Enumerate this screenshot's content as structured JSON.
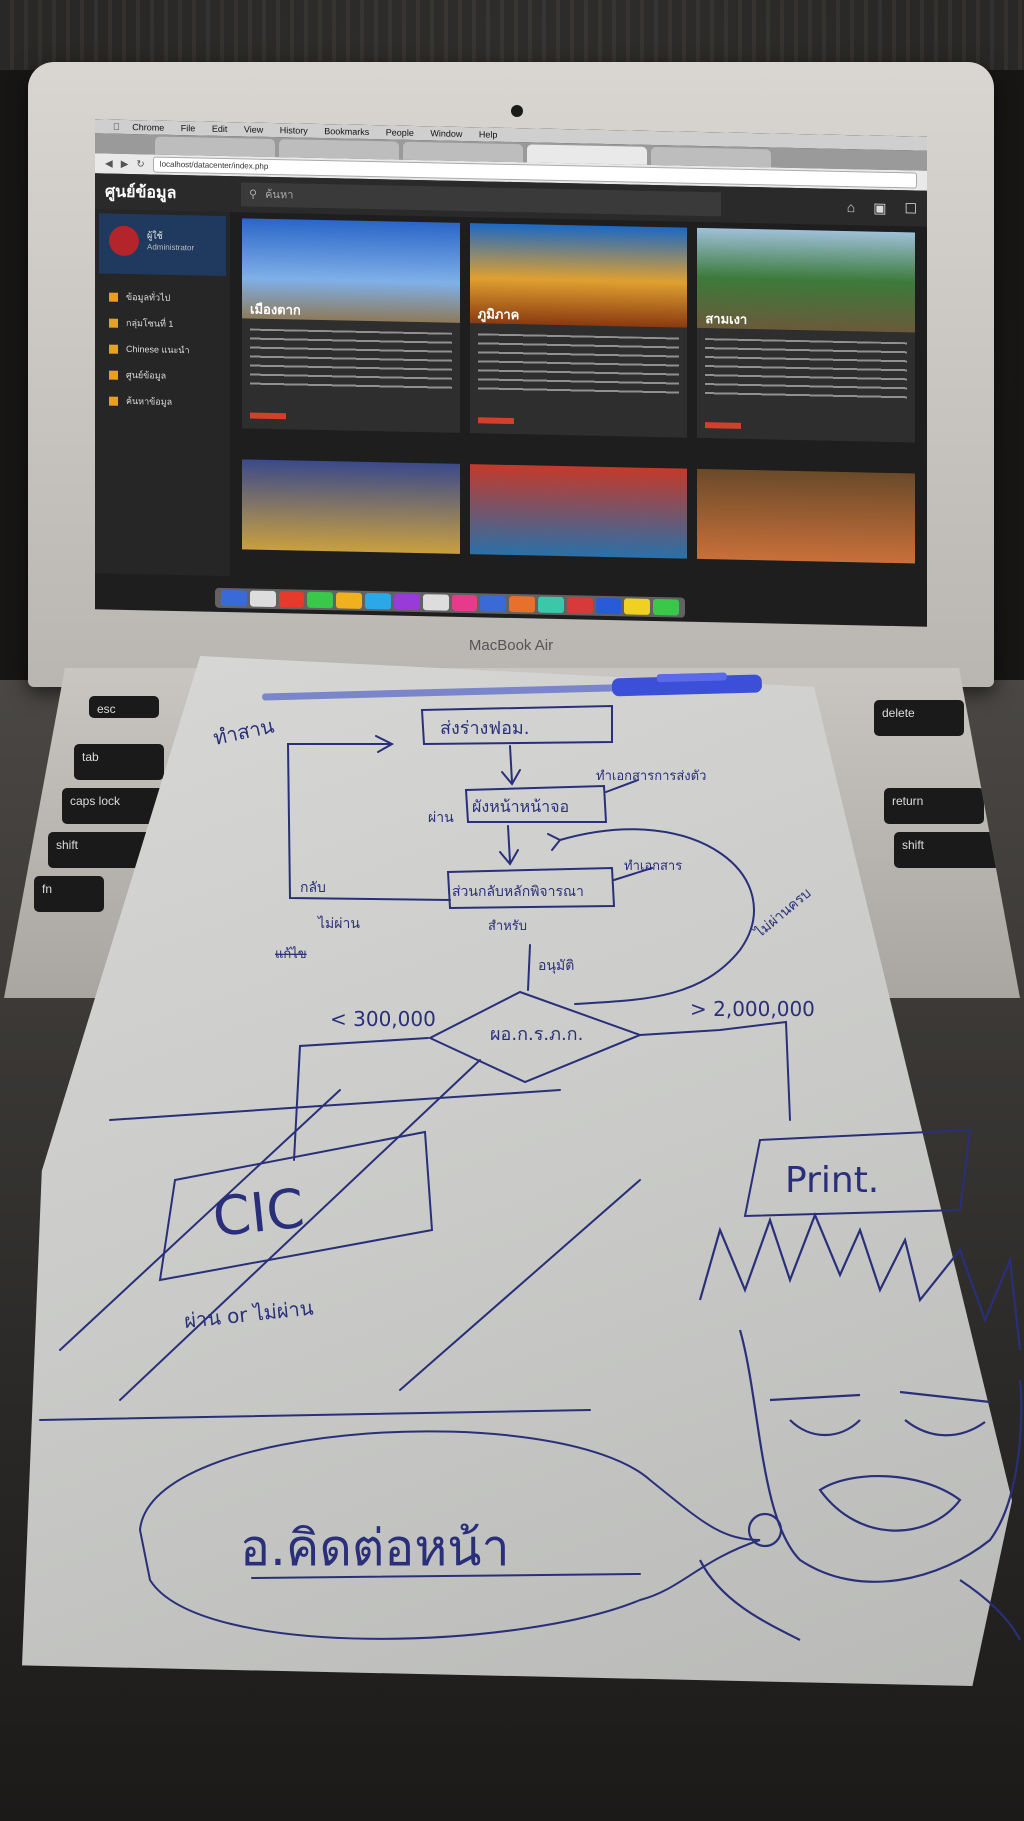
{
  "browser": {
    "menubar": [
      "Chrome",
      "File",
      "Edit",
      "View",
      "History",
      "Bookmarks",
      "People",
      "Window",
      "Help"
    ],
    "url": "localhost/datacenter/index.php"
  },
  "website": {
    "logo": "ศูนย์ข้อมูล",
    "search_placeholder": "ค้นหา",
    "profile_name": "ผู้ใช้",
    "profile_role": "Administrator",
    "sidebar_items": [
      "ข้อมูลทั่วไป",
      "กลุ่มโซนที่ 1",
      "Chinese แนะนำ",
      "ศูนย์ข้อมูล",
      "ค้นหาข้อมูล"
    ],
    "cards": [
      "เมืองตาก",
      "ภูมิภาค",
      "สามเงา"
    ]
  },
  "laptop_label": "MacBook Air",
  "keyboard": {
    "keys": [
      "esc",
      "tab",
      "caps lock",
      "shift",
      "fn",
      "delete",
      "return",
      "shift"
    ]
  },
  "sketch": {
    "label_top_left": "ทำสาน",
    "box_1": "ส่งร่างฟอม.",
    "box_2": "ผังหน้าหน้าจอ",
    "box_2_side": "ทำเอกสารการส่งตัว",
    "pass_label": "ผ่าน",
    "box_3": "ส่วนกลับหลักพิจารณา",
    "box_3_side": "ทำเอกสาร",
    "box_3_below": "สำหรับ",
    "fail_label": "ไม่ผ่าน",
    "strike_label": "แก้ไข",
    "return_label": "กลับ",
    "loop_label": "ไม่ผ่านครบ",
    "approve_label": "อนุมัติ",
    "diamond": "ผอ.ก.ร.ภ.ก.",
    "less_than": "< 300,000",
    "greater_than": "> 2,000,000",
    "cic_box": "CIC",
    "cic_below": "ผ่าน or ไม่ผ่าน",
    "print_box": "Print.",
    "speech": "อ.คิดต่อหน้า"
  },
  "colors": {
    "ink": "#2a2f7a",
    "pen_body": "#3b4fd8",
    "paper": "#d2d3d0"
  }
}
